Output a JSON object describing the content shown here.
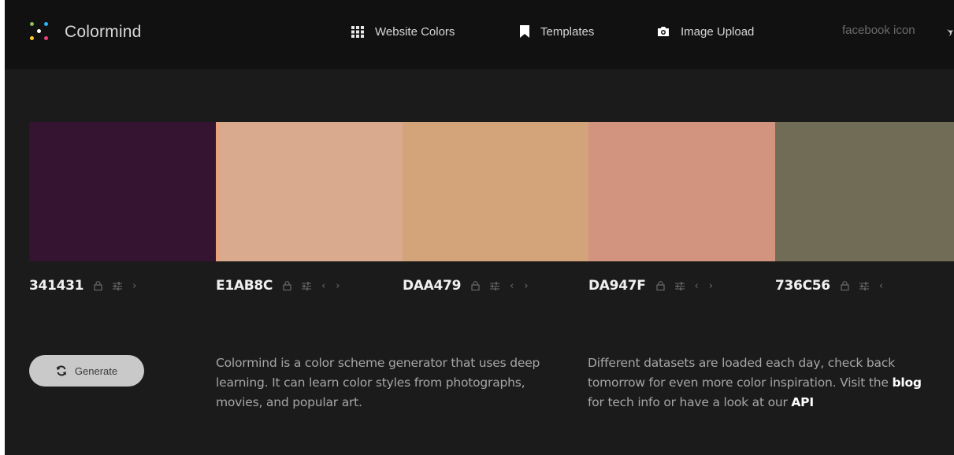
{
  "header": {
    "app_name": "Colormind",
    "nav": [
      {
        "label": "Website Colors",
        "icon": "grid-icon"
      },
      {
        "label": "Templates",
        "icon": "bookmark-icon"
      },
      {
        "label": "Image Upload",
        "icon": "camera-icon"
      }
    ],
    "facebook_text": "facebook icon",
    "twitter_icon": "twitter-icon"
  },
  "palette": [
    {
      "hex": "341431",
      "color": "#341431"
    },
    {
      "hex": "E1AB8C",
      "color": "#DAAA8E"
    },
    {
      "hex": "DAA479",
      "color": "#D3A479"
    },
    {
      "hex": "DA947F",
      "color": "#D3947F"
    },
    {
      "hex": "736C56",
      "color": "#716C55"
    }
  ],
  "colors": {
    "accent_orange_strip": "#E9A27C"
  },
  "generate_label": "Generate",
  "description_left": "Colormind is a color scheme generator that uses deep learning. It can learn color styles from photographs, movies, and popular art.",
  "description_right": {
    "text_before": "Different datasets are loaded each day, check back tomorrow for even more color inspiration. Visit the ",
    "blog_link": "blog",
    "text_middle": " for tech info or have a look at our ",
    "api_link": "API"
  }
}
